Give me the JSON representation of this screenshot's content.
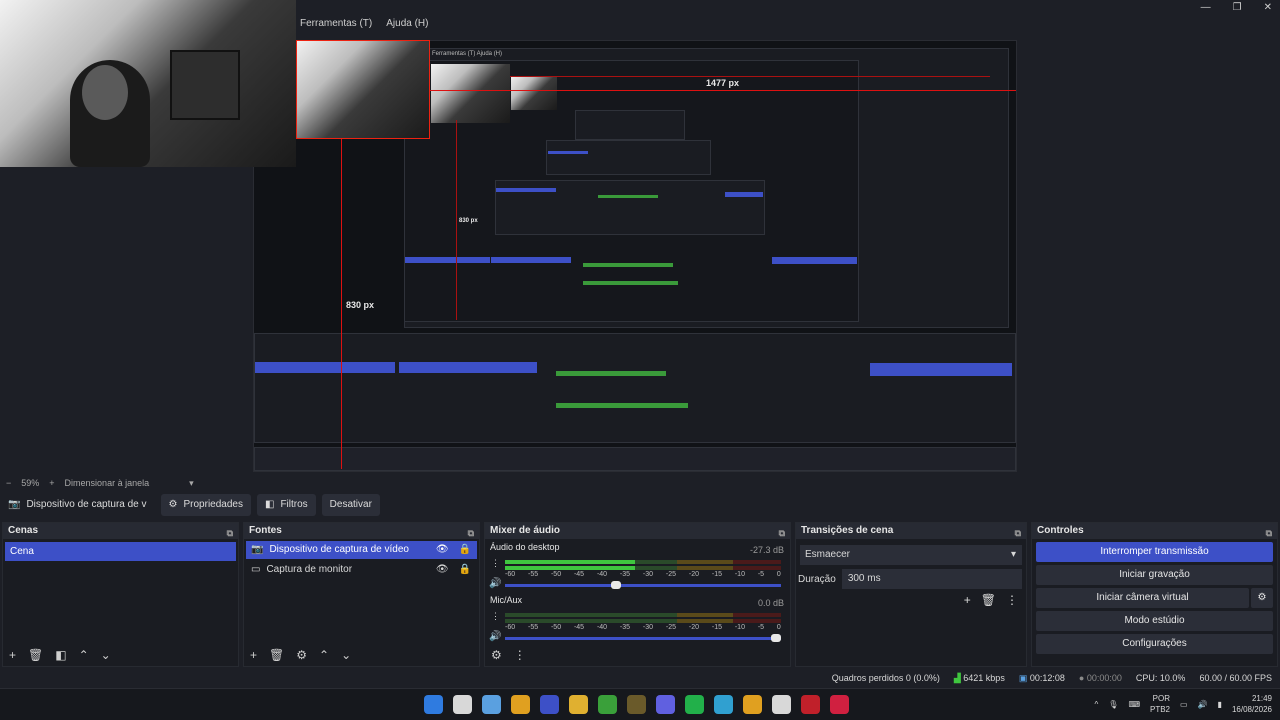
{
  "window": {
    "menus": [
      "Ferramentas (T)",
      "Ajuda (H)"
    ],
    "controls": [
      "—",
      "❐",
      "✕"
    ]
  },
  "preview": {
    "measure_horizontal": "1477 px",
    "measure_vertical": "830 px",
    "inner_measure_vertical": "830 px",
    "inner_menu": "Ferramentas (T)   Ajuda (H)"
  },
  "scale": {
    "minus": "−",
    "percent": "59%",
    "plus": "+",
    "mode": "Dimensionar à janela",
    "dropdown": "▾"
  },
  "source_toolbar": {
    "source_name": "Dispositivo de captura de v",
    "properties": "Propriedades",
    "filters": "Filtros",
    "deactivate": "Desativar"
  },
  "scenes": {
    "title": "Cenas",
    "items": [
      "Cena"
    ]
  },
  "sources": {
    "title": "Fontes",
    "items": [
      {
        "label": "Dispositivo de captura de vídeo",
        "icon": "camera-icon"
      },
      {
        "label": "Captura de monitor",
        "icon": "monitor-icon"
      }
    ]
  },
  "mixer": {
    "title": "Mixer de áudio",
    "channels": [
      {
        "name": "Áudio do desktop",
        "db": "-27.3 dB",
        "level": 0.47,
        "volume": 0.42
      },
      {
        "name": "Mic/Aux",
        "db": "0.0 dB",
        "level": 0.0,
        "volume": 1.0
      }
    ],
    "ticks": [
      "-60",
      "-55",
      "-50",
      "-45",
      "-40",
      "-35",
      "-30",
      "-25",
      "-20",
      "-15",
      "-10",
      "-5",
      "0"
    ]
  },
  "transitions": {
    "title": "Transições de cena",
    "selected": "Esmaecer",
    "duration_label": "Duração",
    "duration_value": "300 ms"
  },
  "controls": {
    "title": "Controles",
    "buttons": [
      "Interromper transmissão",
      "Iniciar gravação",
      "Iniciar câmera virtual",
      "Modo estúdio",
      "Configurações"
    ]
  },
  "status": {
    "dropped": "Quadros perdidos 0 (0.0%)",
    "bitrate": "6421 kbps",
    "stream_time": "00:12:08",
    "rec_time": "00:00:00",
    "cpu": "CPU: 10.0%",
    "fps": "60.00 / 60.00 FPS"
  },
  "taskbar": {
    "lang_top": "POR",
    "lang_bottom": "PTB2",
    "time": "21:49",
    "date": "16/08/2026",
    "tray_arrow": "^",
    "icon_colors": [
      "#2f7be0",
      "#d8d8d8",
      "#5aa0e0",
      "#e0a020",
      "#3d50c7",
      "#e0b030",
      "#3aa03a",
      "#6a5a2a",
      "#6060e0",
      "#22b04a",
      "#30a0d0",
      "#e0a020",
      "#d8d8d8",
      "#c0202a",
      "#d02040"
    ]
  }
}
